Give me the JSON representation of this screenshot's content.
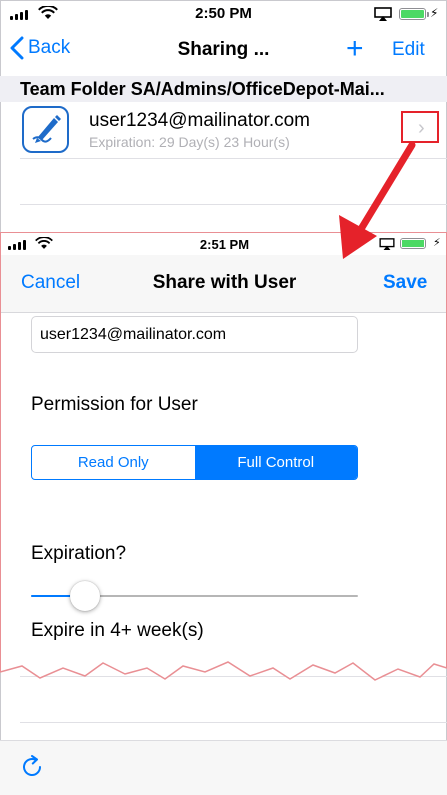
{
  "status_bar": {
    "time": "2:50 PM"
  },
  "nav": {
    "back_label": "Back",
    "title": "Sharing ...",
    "add_label": "+",
    "edit_label": "Edit"
  },
  "section_header": "Team Folder SA/Admins/OfficeDepot-Mai...",
  "share_row": {
    "email": "user1234@mailinator.com",
    "expiration": "Expiration: 29 Day(s) 23 Hour(s)",
    "chevron": "›"
  },
  "overlay": {
    "status_bar": {
      "time": "2:51 PM"
    },
    "nav": {
      "cancel_label": "Cancel",
      "title": "Share with User",
      "save_label": "Save"
    },
    "email_value": "user1234@mailinator.com",
    "permission_label": "Permission for User",
    "permission_options": [
      "Read Only",
      "Full Control"
    ],
    "permission_selected": "Full Control",
    "expiration_label": "Expiration?",
    "expiration_slider_fraction": 0.12,
    "expire_text": "Expire in 4+ week(s)"
  },
  "icons": {
    "back": "chevron-left-icon",
    "app": "document-edit-icon",
    "refresh": "refresh-icon",
    "arrow": "red-arrow-annotation"
  },
  "colors": {
    "accent": "#007aff",
    "annotation": "#e5222a",
    "battery": "#4cd964"
  }
}
